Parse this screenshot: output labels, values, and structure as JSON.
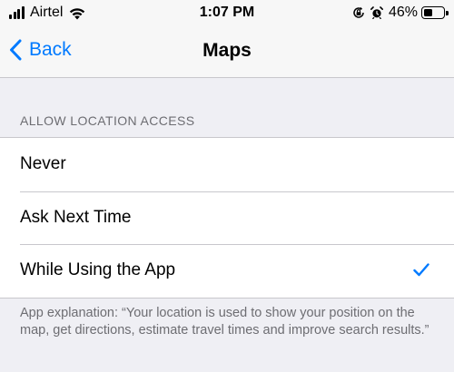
{
  "status_bar": {
    "carrier": "Airtel",
    "time": "1:07 PM",
    "battery_percent_label": "46%",
    "battery_level": 0.46,
    "signal_bars": 4,
    "icons": [
      "signal-icon",
      "wifi-icon",
      "orientation-lock-icon",
      "alarm-icon",
      "battery-icon"
    ]
  },
  "nav": {
    "back_label": "Back",
    "title": "Maps"
  },
  "section": {
    "header": "ALLOW LOCATION ACCESS",
    "options": [
      {
        "label": "Never",
        "selected": false
      },
      {
        "label": "Ask Next Time",
        "selected": false
      },
      {
        "label": "While Using the App",
        "selected": true
      }
    ],
    "footer": "App explanation: “Your location is used to show your position on the map, get directions, estimate travel times and improve search results.”"
  },
  "colors": {
    "accent": "#007aff",
    "background": "#efeff4",
    "secondary_text": "#6d6d72"
  }
}
